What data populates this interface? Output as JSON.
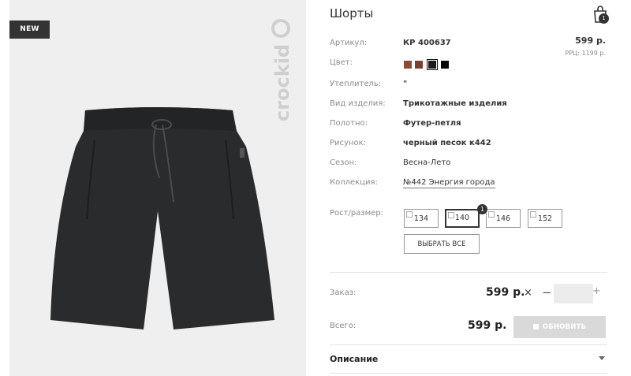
{
  "product": {
    "badge": "NEW",
    "brand_logo_text": "crockid",
    "title": "Шорты",
    "price": "599 р.",
    "rrp": "РРЦ: 1199 р.",
    "cart_count": "1"
  },
  "specs": [
    {
      "label": "Артикул:",
      "value": "КР 400637"
    },
    {
      "label": "Цвет:",
      "value": ""
    },
    {
      "label": "Утеплитель:",
      "value": "\""
    },
    {
      "label": "Вид изделия:",
      "value": "Трикотажные изделия"
    },
    {
      "label": "Полотно:",
      "value": "Футер-петля"
    },
    {
      "label": "Рисунок:",
      "value": "черный песок к442"
    },
    {
      "label": "Сезон:",
      "value": "Весна-Лето"
    },
    {
      "label": "Коллекция:",
      "value": "№442 Энергия города"
    }
  ],
  "colors": [
    {
      "hex": "#8b4a32"
    },
    {
      "hex": "#7b3f2b"
    },
    {
      "hex": "#1b1b1b",
      "selected": true
    },
    {
      "hex": "#050505"
    }
  ],
  "sizes": {
    "label": "Рост/размер:",
    "options": [
      "134",
      "140",
      "146",
      "152"
    ],
    "selected_count_badge": "1",
    "select_all": "ВЫБРАТЬ ВСЕ"
  },
  "order": {
    "label": "Заказ:",
    "price": "599 р.",
    "times": "×",
    "minus": "−",
    "plus": "+",
    "qty": ""
  },
  "total": {
    "label": "Всего:",
    "price": "599 р.",
    "update_button": "ОБНОВИТЬ"
  },
  "description": {
    "label": "Описание"
  }
}
